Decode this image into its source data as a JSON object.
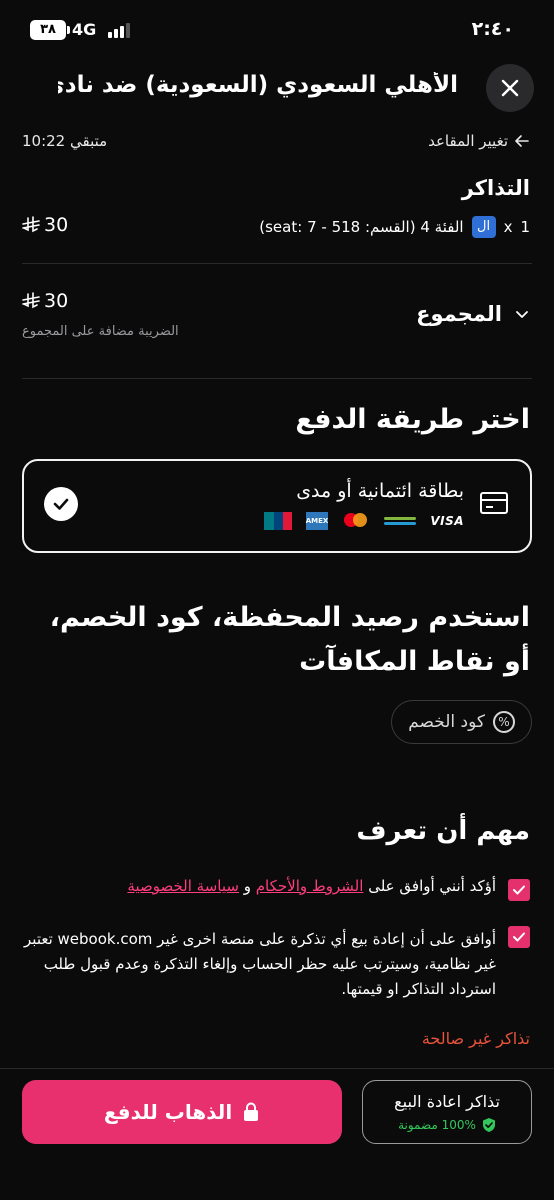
{
  "status_bar": {
    "time": "٢:٤٠",
    "battery": "٣٨",
    "network": "4G"
  },
  "header": {
    "title": "الأهلي السعودي (السعودية) ضد نادي...",
    "close_icon": "close-icon",
    "change_seats": "تغيير المقاعد",
    "timer": "متبقي 10:22"
  },
  "tickets": {
    "heading": "التذاكر",
    "quantity": "1",
    "multiplier": "x",
    "badge": "ال",
    "description": "الفئة 4 (القسم: 518 - 7 :seat)",
    "price": "30",
    "currency_symbol": "⃁"
  },
  "total": {
    "label": "المجموع",
    "price": "30",
    "tax_note": "الضريبة مضافة على المجموع"
  },
  "payment": {
    "heading": "اختر طريقة الدفع",
    "card_option": "بطاقة ائتمانية أو مدى",
    "selected": true,
    "brands": [
      "VISA",
      "mada",
      "mastercard",
      "AMEX",
      "UnionPay"
    ]
  },
  "wallet": {
    "heading": "استخدم رصيد المحفظة، كود الخصم، أو نقاط المكافآت",
    "discount_button": "كود الخصم"
  },
  "important": {
    "heading": "مهم أن تعرف",
    "terms_prefix": "أؤكد أنني أوافق على",
    "terms_link": "الشروط والأحكام",
    "terms_and": "و",
    "privacy_link": "سياسة الخصوصية",
    "resale_text": "أوافق على أن إعادة بيع أي تذكرة على منصة اخرى غير webook.com تعتبر غير نظامية، وسيترتب عليه حظر الحساب وإلغاء التذكرة وعدم قبول طلب استرداد التذاكر او قيمتها.",
    "invalid_tickets": "تذاكر غير صالحة"
  },
  "footer": {
    "pay_button": "الذهاب للدفع",
    "resale_button": "تذاكر اعادة البيع",
    "guaranteed": "100% مضمونة"
  },
  "colors": {
    "accent": "#e8306e",
    "background": "#0b0b0c",
    "link": "#ff3d7f",
    "error": "#e8533a",
    "success": "#34c759"
  }
}
